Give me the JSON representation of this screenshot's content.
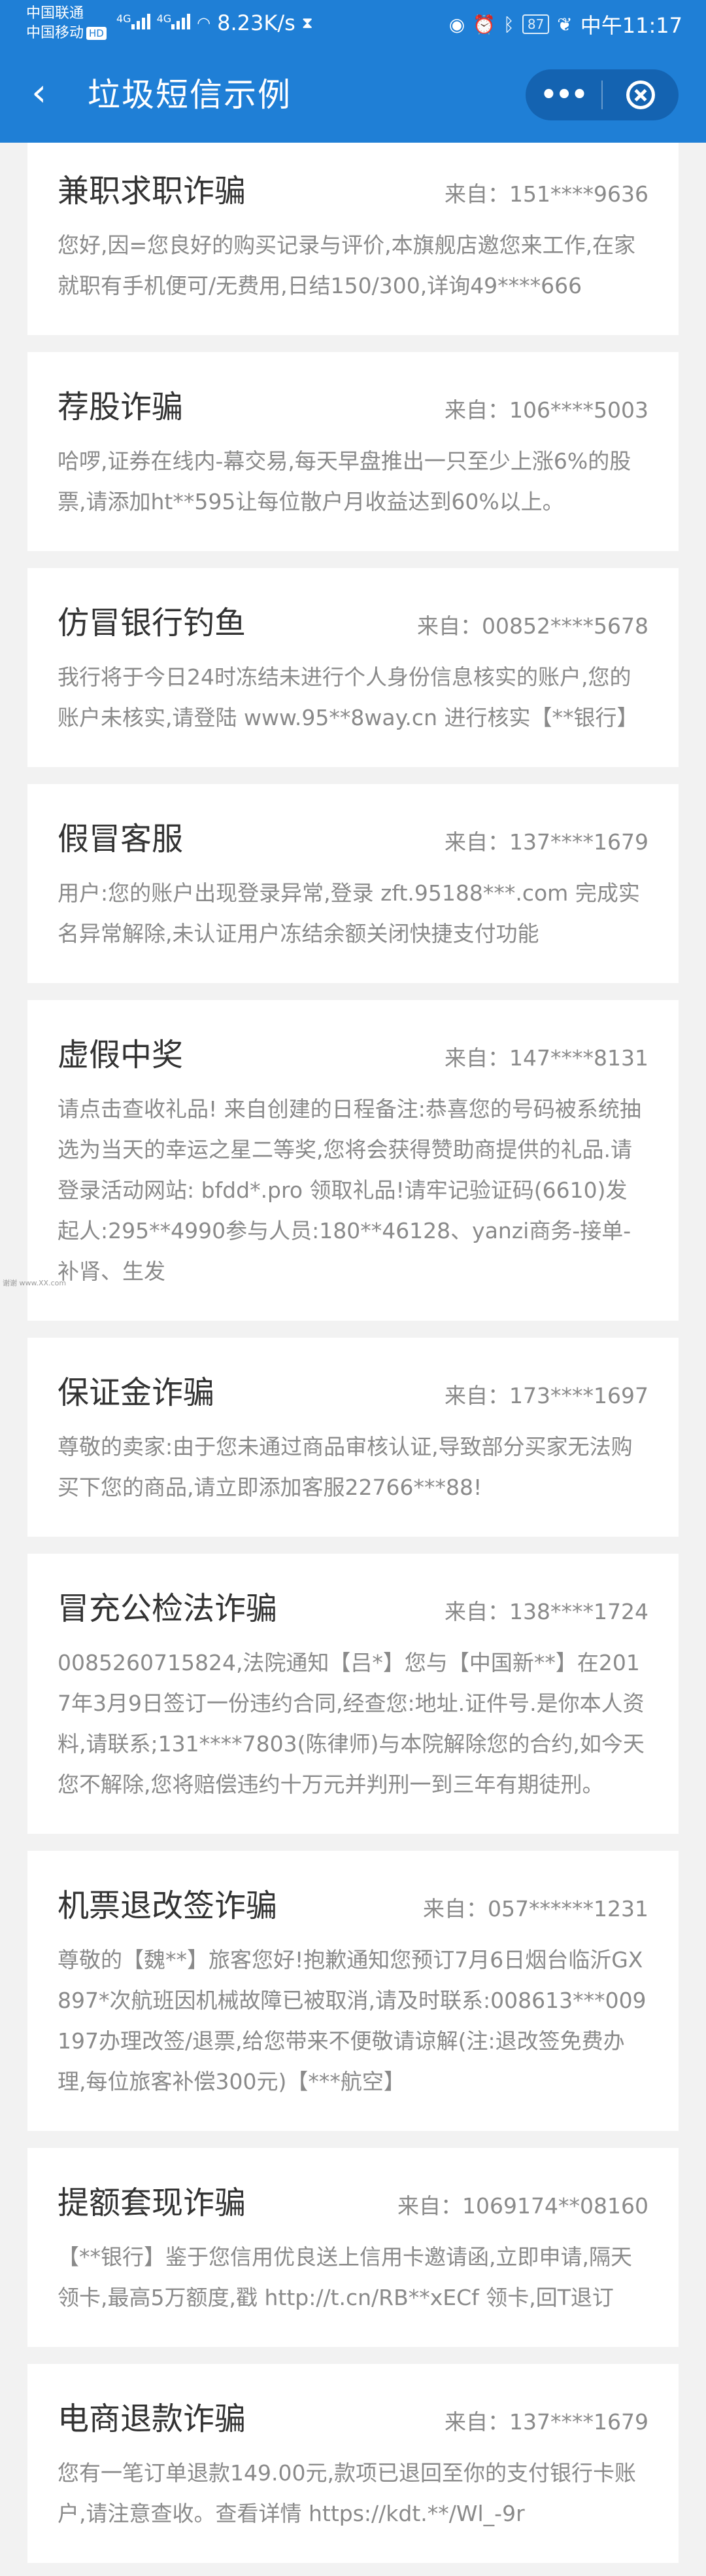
{
  "statusbar": {
    "carrier1": "中国联通",
    "carrier2": "中国移动",
    "hd": "HD",
    "net1": "4G",
    "net2": "4G",
    "speed": "8.23K/s",
    "battery": "87",
    "time": "中午11:17"
  },
  "header": {
    "title": "垃圾短信示例",
    "back_icon": "‹",
    "more_label": "•••"
  },
  "watermark": "谢谢 www.XX.com",
  "cards": [
    {
      "title": "兼职求职诈骗",
      "from": "来自：151****9636",
      "body": "您好,因=您良好的购买记录与评价,本旗舰店邀您来工作,在家就职有手机便可/无费用,日结150/300,详询49****666"
    },
    {
      "title": "荐股诈骗",
      "from": "来自：106****5003",
      "body": "哈啰,证券在线内-幕交易,每天早盘推出一只至少上涨6%的股票,请添加ht**595让每位散户月收益达到60%以上。"
    },
    {
      "title": "仿冒银行钓鱼",
      "from": "来自：00852****5678",
      "body": "我行将于今日24时冻结未进行个人身份信息核实的账户,您的账户未核实,请登陆 www.95**8way.cn 进行核实【**银行】"
    },
    {
      "title": "假冒客服",
      "from": "来自：137****1679",
      "body": "用户:您的账户出现登录异常,登录 zft.95188***.com 完成实名异常解除,未认证用户冻结余额关闭快捷支付功能"
    },
    {
      "title": "虚假中奖",
      "from": "来自：147****8131",
      "body": "请点击查收礼品! 来自创建的日程备注:恭喜您的号码被系统抽选为当天的幸运之星二等奖,您将会获得赞助商提供的礼品.请登录活动网站: bfdd*.pro 领取礼品!请牢记验证码(6610)发起人:295**4990参与人员:180**46128、yanzi商务-接单-补肾、生发"
    },
    {
      "title": "保证金诈骗",
      "from": "来自：173****1697",
      "body": "尊敬的卖家:由于您未通过商品审核认证,导致部分买家无法购买下您的商品,请立即添加客服22766***88!"
    },
    {
      "title": "冒充公检法诈骗",
      "from": "来自：138****1724",
      "body": "0085260715824,法院通知【吕*】您与【中国新**】在2017年3月9日签订一份违约合同,经查您:地址.证件号.是你本人资料,请联系;131****7803(陈律师)与本院解除您的合约,如今天您不解除,您将赔偿违约十万元并判刑一到三年有期徒刑。"
    },
    {
      "title": "机票退改签诈骗",
      "from": "来自：057******1231",
      "body": "尊敬的【魏**】旅客您好!抱歉通知您预订7月6日烟台临沂GX897*次航班因机械故障已被取消,请及时联系:008613***009197办理改签/退票,给您带来不便敬请谅解(注:退改签免费办理,每位旅客补偿300元)【***航空】"
    },
    {
      "title": "提额套现诈骗",
      "from": "来自：1069174**08160",
      "body": "【**银行】鉴于您信用优良送上信用卡邀请函,立即申请,隔天领卡,最高5万额度,戳 http://t.cn/RB**xECf 领卡,回T退订"
    },
    {
      "title": "电商退款诈骗",
      "from": "来自：137****1679",
      "body": "您有一笔订单退款149.00元,款项已退回至你的支付银行卡账户,请注意查收。查看详情 https://kdt.**/Wl_-9r"
    }
  ]
}
